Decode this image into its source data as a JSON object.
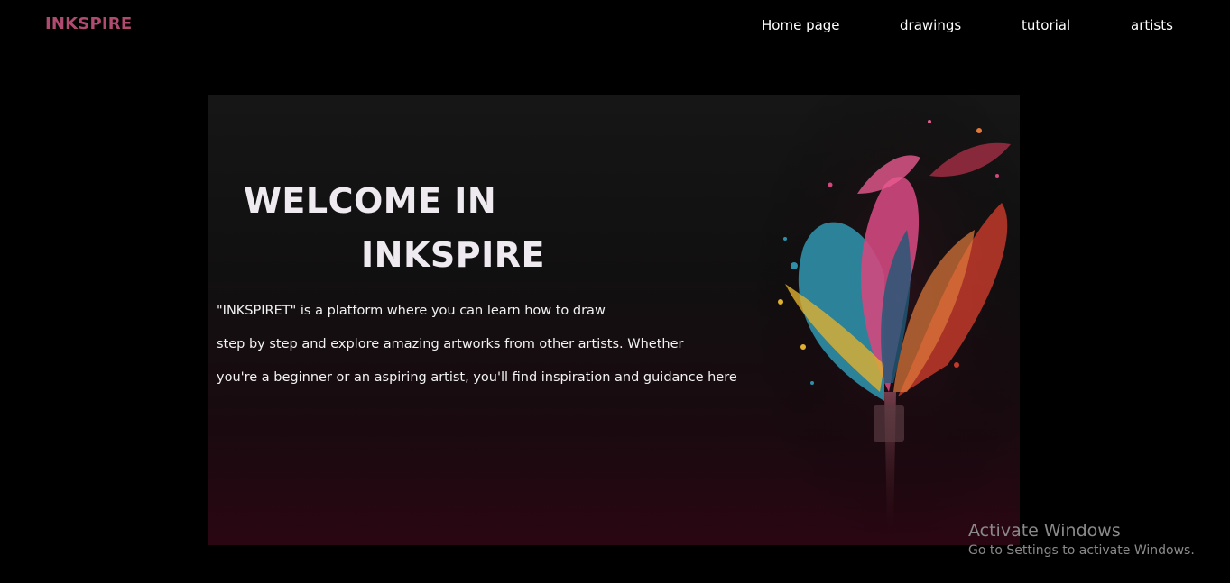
{
  "brand": {
    "logo_text": "INKSPIRE",
    "logo_color": "#b04a6e"
  },
  "nav": {
    "items": [
      {
        "label": "Home page"
      },
      {
        "label": "drawings"
      },
      {
        "label": "tutorial"
      },
      {
        "label": "artists"
      }
    ]
  },
  "hero": {
    "title_line_1": "WELCOME IN",
    "title_line_2": "INKSPIRE",
    "description_lines": [
      "\"INKSPIRET\" is a platform where you can learn how to draw",
      "step by step and explore amazing artworks from other artists. Whether",
      "you're a beginner or an aspiring artist, you'll find inspiration and guidance here"
    ],
    "image": "paint-brush-splash-art",
    "accent_colors": [
      "#e0407a",
      "#2f8fa8",
      "#d23a2a",
      "#e0b030"
    ]
  },
  "watermark": {
    "title": "Activate Windows",
    "subtitle": "Go to Settings to activate Windows."
  }
}
